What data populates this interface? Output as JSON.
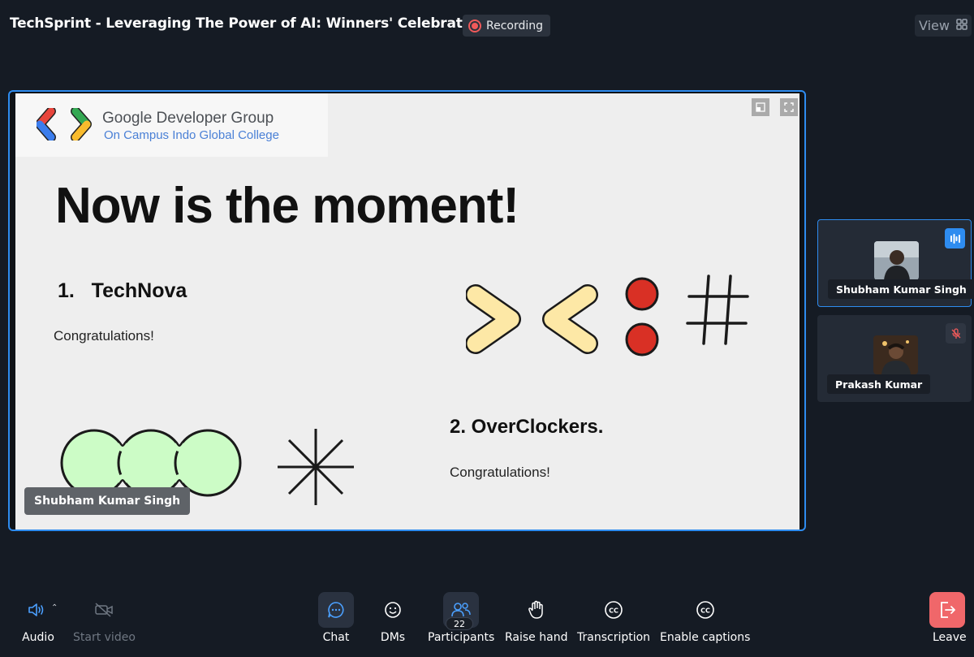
{
  "header": {
    "meeting_title": "TechSprint - Leveraging The Power of AI: Winners' Celebration",
    "recording_label": "Recording",
    "view_label": "View"
  },
  "slide": {
    "org_name": "Google Developer Group",
    "org_campus": "On Campus Indo Global College",
    "heading": "Now is the moment!",
    "winner_1": "1.   TechNova",
    "winner_1_message": "Congratulations!",
    "winner_2": "2. OverClockers.",
    "winner_2_message": "Congratulations!"
  },
  "stage": {
    "presenter_name": "Shubham Kumar Singh"
  },
  "participants": [
    {
      "name": "Shubham Kumar Singh",
      "status": "speaking"
    },
    {
      "name": "Prakash Kumar",
      "status": "muted"
    }
  ],
  "toolbar": {
    "audio_label": "Audio",
    "start_video_label": "Start video",
    "chat_label": "Chat",
    "dms_label": "DMs",
    "participants_label": "Participants",
    "participants_count": "22",
    "raise_hand_label": "Raise hand",
    "transcription_label": "Transcription",
    "captions_label": "Enable captions",
    "leave_label": "Leave"
  },
  "colors": {
    "background": "#151b24",
    "accent": "#2e8cf0",
    "recording": "#f05a5a",
    "leave": "#f0676a"
  },
  "icons": [
    "recording-icon",
    "grid-view-icon",
    "speaker-icon",
    "video-off-icon",
    "chat-icon",
    "dms-icon",
    "participants-icon",
    "raise-hand-icon",
    "cc-icon",
    "leave-icon",
    "mic-muted-icon",
    "audio-wave-icon",
    "pip-icon",
    "fullscreen-icon"
  ]
}
